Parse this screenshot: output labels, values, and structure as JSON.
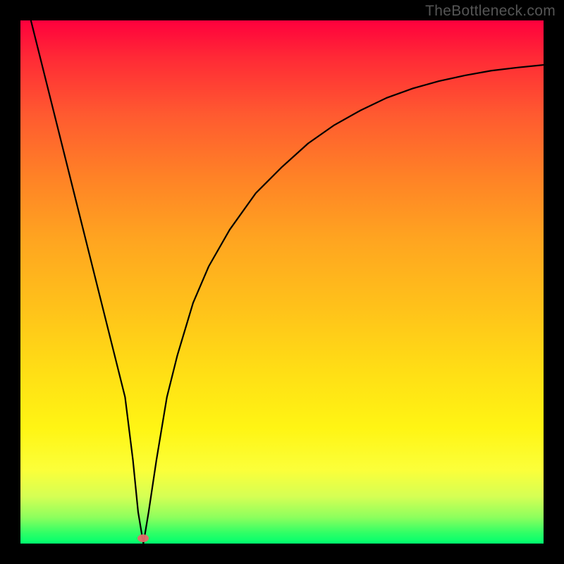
{
  "source_text": "TheBottleneck.com",
  "chart_data": {
    "type": "line",
    "title": "",
    "xlabel": "",
    "ylabel": "",
    "xlim": [
      0,
      100
    ],
    "ylim": [
      0,
      100
    ],
    "grid": false,
    "legend": false,
    "background": "red-to-green vertical gradient (red top, green bottom)",
    "series": [
      {
        "name": "bottleneck-curve",
        "x": [
          2,
          5,
          10,
          15,
          18,
          20,
          21.5,
          22.5,
          23.5,
          24.5,
          26,
          28,
          30,
          33,
          36,
          40,
          45,
          50,
          55,
          60,
          65,
          70,
          75,
          80,
          85,
          90,
          95,
          100
        ],
        "y": [
          100,
          88,
          68,
          48,
          36,
          28,
          16,
          6,
          0,
          6,
          16,
          28,
          36,
          46,
          53,
          60,
          67,
          72,
          76.5,
          80,
          82.8,
          85.2,
          87,
          88.4,
          89.5,
          90.4,
          91,
          91.5
        ]
      }
    ],
    "markers": [
      {
        "name": "optimal-point",
        "x": 23.5,
        "y": 1,
        "color": "#e46a6a"
      }
    ],
    "colors": {
      "curve": "#000000",
      "frame": "#000000",
      "gradient_top": "#ff003d",
      "gradient_bottom": "#00ff6e",
      "marker": "#e46a6a"
    }
  }
}
